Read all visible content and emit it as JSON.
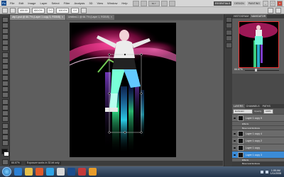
{
  "menubar": {
    "logo": "Ps",
    "items": [
      "File",
      "Edit",
      "Image",
      "Layer",
      "Select",
      "Filter",
      "Analysis",
      "3D",
      "View",
      "Window",
      "Help"
    ],
    "zoom_value": "66.7",
    "workspace_tabs": [
      "ESSENTIALS",
      "DESIGN",
      "PAINTING"
    ],
    "window_buttons": [
      "_",
      "□",
      "×"
    ]
  },
  "options": {
    "field1": "400.00",
    "field2": "400.0%",
    "field3": "0.0",
    "field4": "100.0%",
    "field5": "0.0"
  },
  "document_tabs": [
    {
      "label": "wip1.psd @ 66.7% (Layer 1 copy 3, RGB/8)",
      "active": true
    },
    {
      "label": "Untitled-1 @ 66.7% (Layer 1, RGB/8)",
      "active": false
    }
  ],
  "status": {
    "zoom": "66.67%",
    "info": "Exposure works in 32-bit only"
  },
  "navigator": {
    "tabs": [
      "HISTOGRAM",
      "NAVIGATOR"
    ],
    "zoom": "66.67%"
  },
  "layers": {
    "tabs": [
      "LAYERS",
      "CHANNELS",
      "PATHS"
    ],
    "blend_mode": "Exclusion",
    "opacity_label": "Opacity:",
    "opacity": "100%",
    "fill_label": "Fill:",
    "fill": "100%",
    "rows": [
      {
        "name": "Layer 1 copy 5",
        "type": "layer"
      },
      {
        "name": "Effects",
        "type": "fx"
      },
      {
        "name": "Bevel and Emboss",
        "type": "fx"
      },
      {
        "name": "Layer 1 copy 4",
        "type": "layer"
      },
      {
        "name": "Layer 1 copy 2",
        "type": "layer"
      },
      {
        "name": "Layer 1 copy",
        "type": "layer"
      },
      {
        "name": "Layer 1 copy 3",
        "type": "layer",
        "selected": true
      },
      {
        "name": "Effects",
        "type": "fx"
      },
      {
        "name": "Bevel and Emboss",
        "type": "fx"
      }
    ]
  },
  "taskbar": {
    "time": "1:05 AM",
    "date": "1/11/2008"
  },
  "colors": {
    "accent": "#3b8bd6",
    "neon_pink": "#ff2f8a",
    "neon_green": "#38ff8a",
    "neon_cyan": "#29c7ff"
  }
}
